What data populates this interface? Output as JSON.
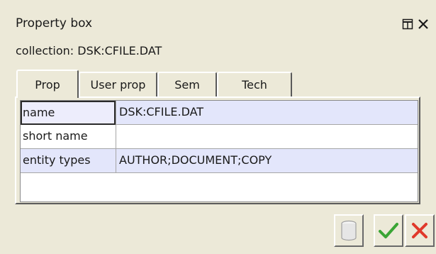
{
  "window": {
    "title": "Property box",
    "collection_label": "collection: DSK:CFILE.DAT"
  },
  "title_buttons": [
    {
      "name": "restore",
      "icon": "restore-icon"
    },
    {
      "name": "close",
      "icon": "close-icon"
    }
  ],
  "tabs": [
    {
      "label": "Prop",
      "active": true
    },
    {
      "label": "User prop",
      "active": false
    },
    {
      "label": "Sem",
      "active": false
    },
    {
      "label": "Tech",
      "active": false
    }
  ],
  "properties": [
    {
      "key": "name",
      "value": "DSK:CFILE.DAT"
    },
    {
      "key": "short name",
      "value": ""
    },
    {
      "key": "entity types",
      "value": "AUTHOR;DOCUMENT;COPY"
    }
  ],
  "actions": [
    {
      "name": "store",
      "icon": "cylinder-icon",
      "enabled": false
    },
    {
      "name": "apply",
      "icon": "checkmark-icon",
      "color": "#3aa535"
    },
    {
      "name": "cancel",
      "icon": "x-icon",
      "color": "#e0392b"
    }
  ],
  "colors": {
    "selected_cell": "#ededfc",
    "row_highlight": "#e3e6fb",
    "chrome": "#ece9d8"
  }
}
